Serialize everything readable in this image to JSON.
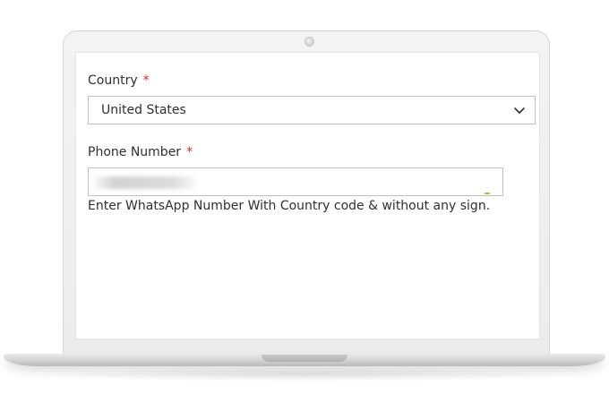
{
  "form": {
    "country": {
      "label": "Country",
      "required_mark": "*",
      "selected_value": "United States"
    },
    "phone": {
      "label": "Phone Number",
      "required_mark": "*",
      "value": "",
      "hint": "Enter WhatsApp Number With Country code & without any sign."
    }
  },
  "colors": {
    "required": "#e02b27",
    "text": "#303030",
    "border": "#c2c2c2"
  },
  "icons": {
    "select_chevron": "chevron-down-icon"
  }
}
